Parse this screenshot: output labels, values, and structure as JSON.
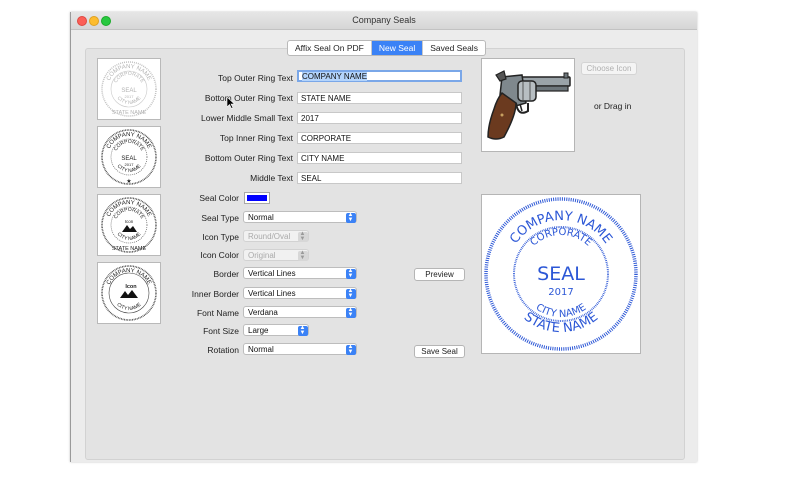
{
  "window": {
    "title": "Company Seals"
  },
  "tabs": [
    {
      "label": "Affix Seal On PDF",
      "active": false
    },
    {
      "label": "New Seal",
      "active": true
    },
    {
      "label": "Saved Seals",
      "active": false
    }
  ],
  "thumbnails": [
    {
      "top": "COMPANY NAME",
      "inner_top": "CORPORATE",
      "middle": "SEAL",
      "small": "2017",
      "inner_bottom": "CITY NAME",
      "bottom": "STATE NAME"
    },
    {
      "top": "COMPANY NAME",
      "inner_top": "CORPORATE",
      "middle": "SEAL",
      "small": "2017",
      "inner_bottom": "CITY NAME"
    },
    {
      "top": "COMPANY NAME",
      "inner_top": "CORPORATE",
      "middle": "Icon",
      "small": "",
      "inner_bottom": "CITY NAME",
      "bottom": "STATE NAME"
    },
    {
      "top": "COMPANY NAME",
      "middle": "Icon",
      "inner_bottom": "CITY NAME"
    }
  ],
  "form": {
    "top_outer_ring": {
      "label": "Top Outer Ring Text",
      "value": "COMPANY NAME"
    },
    "bottom_outer_ring_1": {
      "label": "Bottom Outer Ring Text",
      "value": "STATE NAME"
    },
    "lower_middle_small": {
      "label": "Lower Middle Small Text",
      "value": "2017"
    },
    "top_inner_ring": {
      "label": "Top Inner Ring Text",
      "value": "CORPORATE"
    },
    "bottom_outer_ring_2": {
      "label": "Bottom Outer Ring Text",
      "value": "CITY NAME"
    },
    "middle_text": {
      "label": "Middle Text",
      "value": "SEAL"
    },
    "seal_color": {
      "label": "Seal Color",
      "color": "#0000ff"
    },
    "seal_type": {
      "label": "Seal Type",
      "value": "Normal"
    },
    "icon_type": {
      "label": "Icon Type",
      "value": "Round/Oval"
    },
    "icon_color": {
      "label": "Icon Color",
      "value": "Original"
    },
    "border": {
      "label": "Border",
      "value": "Vertical Lines"
    },
    "inner_border": {
      "label": "Inner Border",
      "value": "Vertical Lines"
    },
    "font_name": {
      "label": "Font Name",
      "value": "Verdana"
    },
    "font_size": {
      "label": "Font Size",
      "value": "Large"
    },
    "rotation": {
      "label": "Rotation",
      "value": "Normal"
    }
  },
  "buttons": {
    "choose_icon": "Choose Icon",
    "or_drag_in": "or Drag in",
    "preview": "Preview",
    "save_seal": "Save Seal"
  },
  "preview": {
    "color": "#2c57d6",
    "top": "COMPANY NAME",
    "inner_top": "CORPORATE",
    "middle": "SEAL",
    "small": "2017",
    "inner_bottom": "CITY NAME",
    "bottom": "STATE NAME"
  },
  "icons": [
    "revolver-icon",
    "arrow-pointer-icon"
  ]
}
